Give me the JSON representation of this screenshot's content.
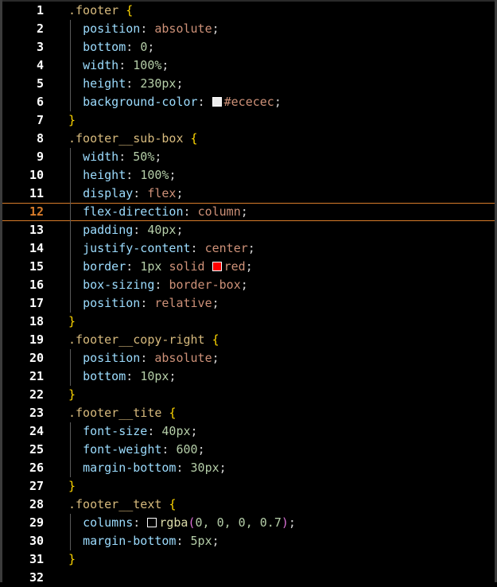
{
  "editor": {
    "active_line": "12",
    "lines": [
      {
        "n": "1",
        "selector": ".footer",
        "open": "{"
      },
      {
        "n": "2",
        "prop": "position",
        "value": "absolute"
      },
      {
        "n": "3",
        "prop": "bottom",
        "value": "0"
      },
      {
        "n": "4",
        "prop": "width",
        "value": "100%"
      },
      {
        "n": "5",
        "prop": "height",
        "value": "230px"
      },
      {
        "n": "6",
        "prop": "background-color",
        "value": "#ececec",
        "swatch": "#ececec"
      },
      {
        "n": "7",
        "close": "}"
      },
      {
        "n": "8",
        "selector": ".footer__sub-box",
        "open": "{"
      },
      {
        "n": "9",
        "prop": "width",
        "value": "50%"
      },
      {
        "n": "10",
        "prop": "height",
        "value": "100%"
      },
      {
        "n": "11",
        "prop": "display",
        "value": "flex"
      },
      {
        "n": "12",
        "prop": "flex-direction",
        "value": "column"
      },
      {
        "n": "13",
        "prop": "padding",
        "value": "40px"
      },
      {
        "n": "14",
        "prop": "justify-content",
        "value": "center"
      },
      {
        "n": "15",
        "prop": "border",
        "value_num": "1px",
        "value_kw": "solid",
        "value_color": "red",
        "swatch": "#ff0000"
      },
      {
        "n": "16",
        "prop": "box-sizing",
        "value": "border-box"
      },
      {
        "n": "17",
        "prop": "position",
        "value": "relative"
      },
      {
        "n": "18",
        "close": "}"
      },
      {
        "n": "19",
        "selector": ".footer__copy-right",
        "open": "{"
      },
      {
        "n": "20",
        "prop": "position",
        "value": "absolute"
      },
      {
        "n": "21",
        "prop": "bottom",
        "value": "10px"
      },
      {
        "n": "22",
        "close": "}"
      },
      {
        "n": "23",
        "selector": ".footer__tite",
        "open": "{"
      },
      {
        "n": "24",
        "prop": "font-size",
        "value": "40px"
      },
      {
        "n": "25",
        "prop": "font-weight",
        "value": "600"
      },
      {
        "n": "26",
        "prop": "margin-bottom",
        "value": "30px"
      },
      {
        "n": "27",
        "close": "}"
      },
      {
        "n": "28",
        "selector": ".footer__text",
        "open": "{"
      },
      {
        "n": "29",
        "prop": "columns",
        "fn_name": "rgba",
        "args": "0, 0, 0, 0.7",
        "swatch": "rgba(0, 0, 0, 0.7)"
      },
      {
        "n": "30",
        "prop": "margin-bottom",
        "value": "5px"
      },
      {
        "n": "31",
        "close": "}"
      },
      {
        "n": "32"
      }
    ]
  },
  "colors": {
    "background": "#000000",
    "active_line_border": "#d87c2a",
    "selector": "#d7ba7d",
    "property": "#9cdcfe",
    "keyword": "#ce9178",
    "number": "#b5cea8"
  }
}
